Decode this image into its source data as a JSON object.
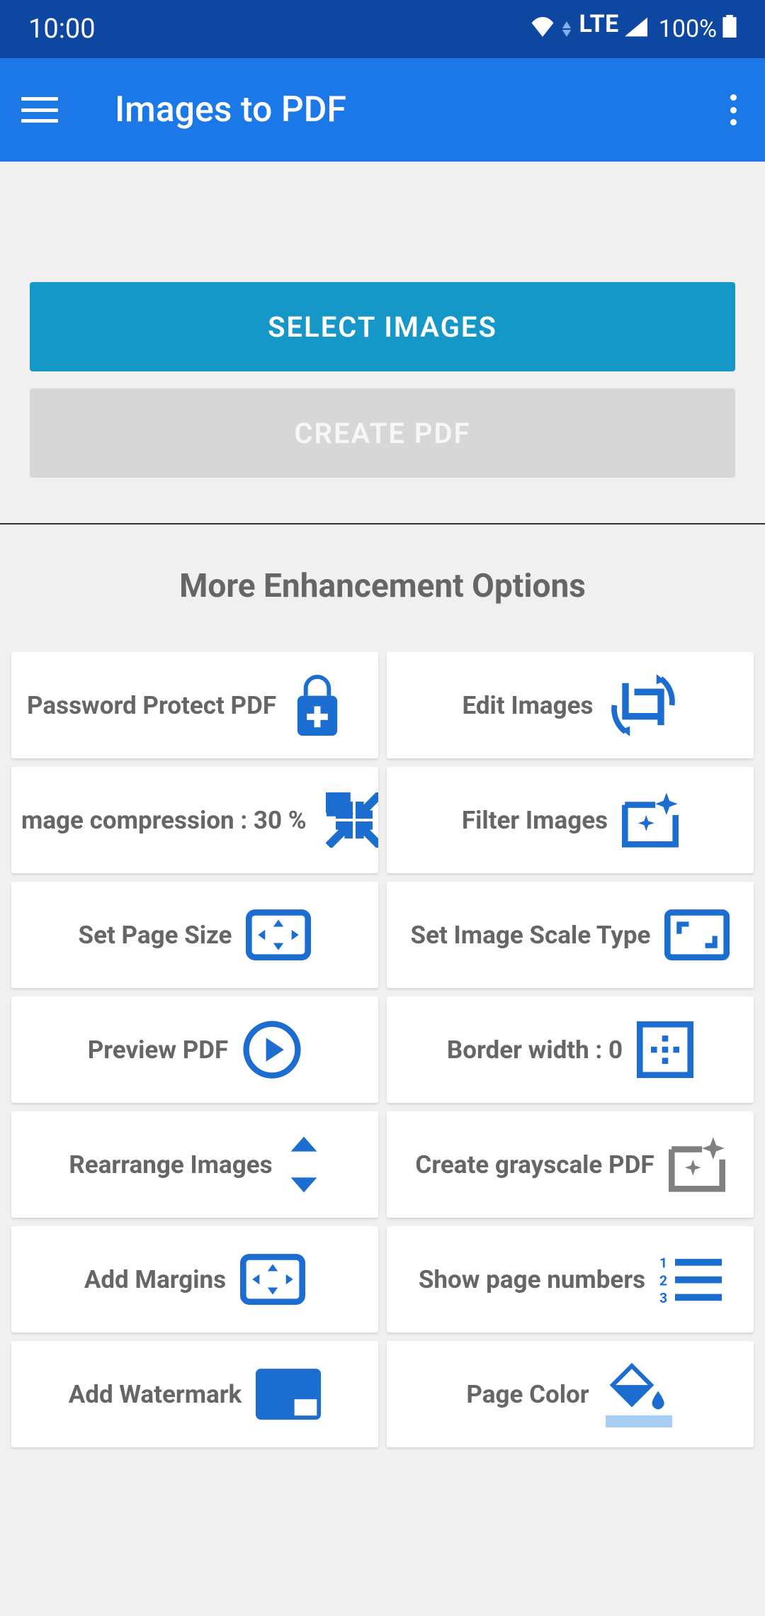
{
  "status_bar": {
    "time": "10:00",
    "battery": "100%"
  },
  "app_bar": {
    "title": "Images to PDF"
  },
  "buttons": {
    "select_images": "SELECT IMAGES",
    "create_pdf": "CREATE PDF"
  },
  "section_title": "More Enhancement Options",
  "options": {
    "password_protect": "Password Protect PDF",
    "edit_images": "Edit Images",
    "compression": "mage compression : 30 %",
    "filter_images": "Filter Images",
    "set_page_size": "Set Page Size",
    "set_scale_type": "Set Image Scale Type",
    "preview_pdf": "Preview PDF",
    "border_width": "Border width : 0",
    "rearrange_images": "Rearrange Images",
    "grayscale": "Create grayscale PDF",
    "add_margins": "Add Margins",
    "page_numbers": "Show page numbers",
    "add_watermark": "Add Watermark",
    "page_color": "Page Color"
  }
}
